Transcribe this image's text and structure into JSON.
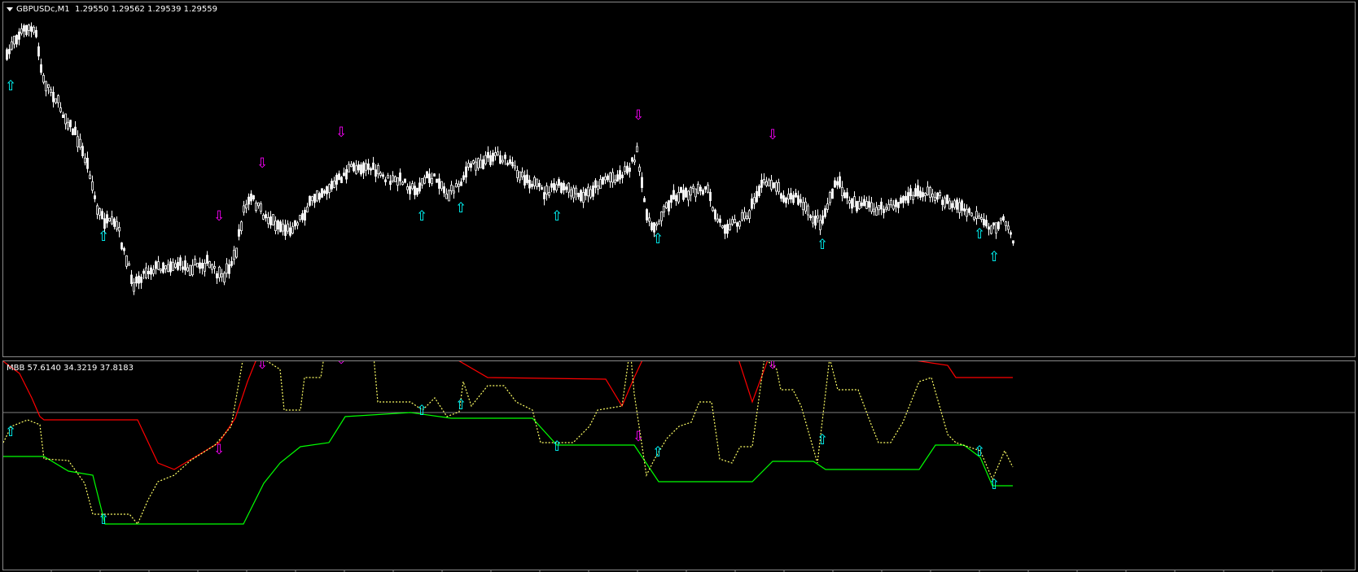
{
  "window": {
    "symbol_label": "GBPUSDc,M1  1.29550 1.29562 1.29539 1.29559"
  },
  "indicator": {
    "label": "MBB 57.6140 34.3219 37.8183"
  },
  "colors": {
    "background": "#000000",
    "candle": "#ffffff",
    "up_arrow": "#00ffff",
    "down_arrow": "#ff00ff",
    "upper_band": "#ff0000",
    "lower_band": "#00ff00",
    "signal_line": "#ffff66",
    "level_line": "#808080"
  },
  "icons": {
    "up_signal": "up-arrow-outline-icon",
    "down_signal": "down-arrow-outline-icon",
    "label_menu": "triangle-down-icon"
  }
}
